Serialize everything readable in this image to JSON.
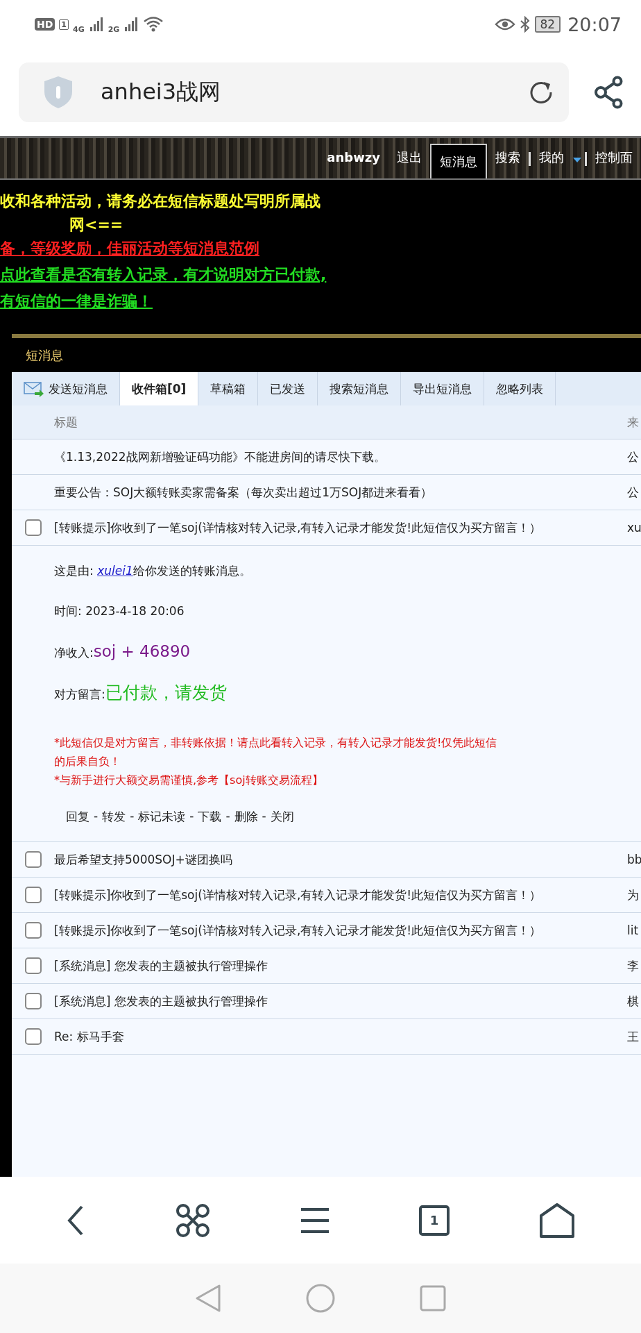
{
  "status_bar": {
    "hd": "HD",
    "sim": "1",
    "networks": [
      "4G",
      "2G"
    ],
    "battery": "82",
    "time": "20:07"
  },
  "address_bar": {
    "title": "anhei3战网"
  },
  "site_nav": [
    {
      "label": "anbwzy",
      "kind": "user",
      "selected": false
    },
    {
      "label": "退出",
      "kind": "link",
      "selected": false
    },
    {
      "label": "短消息",
      "kind": "link",
      "selected": true
    },
    {
      "label": "搜索",
      "kind": "link",
      "selected": false
    },
    {
      "label": "我的",
      "kind": "menu",
      "selected": false
    },
    {
      "label": "控制面",
      "kind": "link",
      "selected": false
    }
  ],
  "notices": [
    {
      "text": "收和各种活动，请务必在短信标题处写明所属战",
      "color": "#ffff33",
      "kind": "plain"
    },
    {
      "text": "网<==",
      "color": "#ffff33",
      "kind": "indent"
    },
    {
      "text": "备，等级奖励，佳丽活动等短消息范例",
      "color": "#ff2020",
      "kind": "link"
    },
    {
      "text": "点此查看是否有转入记录，有才说明对方已付款,",
      "color": "#22dd22",
      "kind": "link"
    },
    {
      "text": "有短信的一律是诈骗！",
      "color": "#22dd22",
      "kind": "link"
    }
  ],
  "panel": {
    "title": "短消息",
    "tabs": [
      {
        "label": "发送短消息",
        "kind": "compose",
        "selected": false
      },
      {
        "label": "收件箱[0]",
        "kind": "tab",
        "selected": true
      },
      {
        "label": "草稿箱",
        "kind": "tab",
        "selected": false
      },
      {
        "label": "已发送",
        "kind": "tab",
        "selected": false
      },
      {
        "label": "搜索短消息",
        "kind": "tab",
        "selected": false
      },
      {
        "label": "导出短消息",
        "kind": "tab",
        "selected": false
      },
      {
        "label": "忽略列表",
        "kind": "tab",
        "selected": false
      }
    ],
    "columns": [
      "标题",
      "来"
    ],
    "messages": [
      {
        "kind": "notice",
        "title": "《1.13,2022战网新增验证码功能》不能进房间的请尽快下载。",
        "sender": "公"
      },
      {
        "kind": "notice",
        "title": "重要公告：SOJ大额转账卖家需备案（每次卖出超过1万SOJ都进来看看）",
        "sender": "公"
      },
      {
        "kind": "message",
        "checked": false,
        "title": "[转账提示]你收到了一笔soj(详情核对转入记录,有转入记录才能发货!此短信仅为买方留言！）",
        "sender": "xu",
        "detail": {
          "from_label": "这是由: ",
          "from_user": "xulei1",
          "from_tail": "给你发送的转账消息。",
          "time": "时间: 2023-4-18 20:06",
          "income_label": "净收入:",
          "income": "soj + 46890",
          "note_label": "对方留言:",
          "note": "已付款，请发货",
          "warnings": [
            "*此短信仅是对方留言，非转账依据！请点此看转入记录，有转入记录才能发货!仅凭此短信",
            "的后果自负！",
            "*与新手进行大额交易需谨慎,参考【soj转账交易流程】"
          ],
          "actions": [
            "回复",
            "转发",
            "标记未读",
            "下载",
            "删除",
            "关闭"
          ],
          "separator": "-"
        }
      },
      {
        "kind": "message",
        "checked": false,
        "title": "最后希望支持5000SOJ+谜团换吗",
        "sender": "bb"
      },
      {
        "kind": "message",
        "checked": false,
        "title": "[转账提示]你收到了一笔soj(详情核对转入记录,有转入记录才能发货!此短信仅为买方留言！）",
        "sender": "为"
      },
      {
        "kind": "message",
        "checked": false,
        "title": "[转账提示]你收到了一笔soj(详情核对转入记录,有转入记录才能发货!此短信仅为买方留言！）",
        "sender": "lit"
      },
      {
        "kind": "message",
        "checked": false,
        "title": "[系统消息] 您发表的主题被执行管理操作",
        "sender": "李"
      },
      {
        "kind": "message",
        "checked": false,
        "title": "[系统消息] 您发表的主题被执行管理操作",
        "sender": "棋"
      },
      {
        "kind": "message",
        "checked": false,
        "title": "Re: 标马手套",
        "sender": "王"
      }
    ]
  },
  "browser_toolbar": {
    "tab_count": "1"
  }
}
